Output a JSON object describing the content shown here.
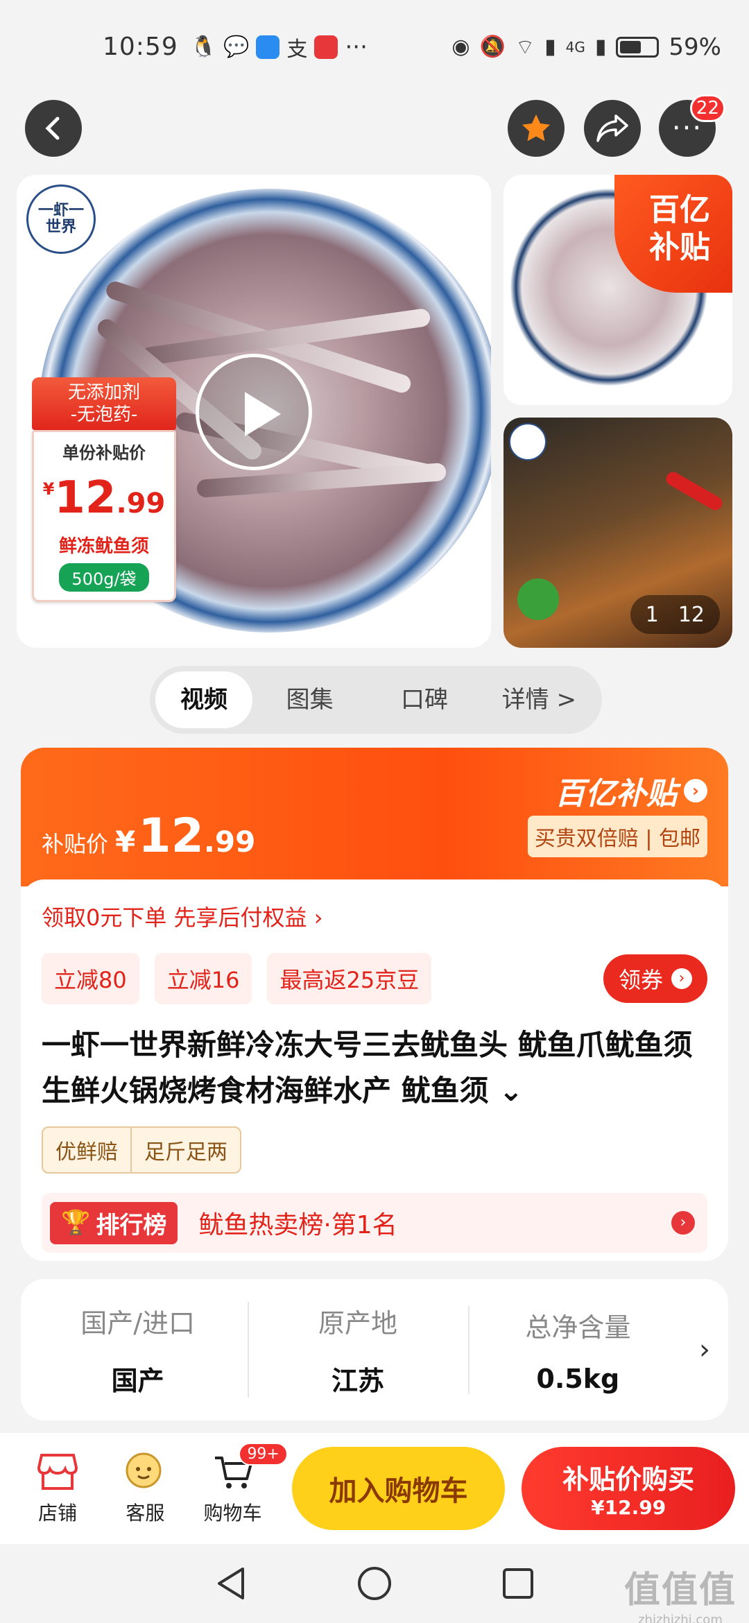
{
  "status_bar": {
    "time": "10:59",
    "battery": "59%",
    "network": "4G",
    "battery_level": 0.59
  },
  "nav": {
    "notification_count": "22"
  },
  "media": {
    "brand": "一虾一世界",
    "tag_top": [
      "无添加剂",
      "-无泡药-"
    ],
    "tag_label": "单份补贴价",
    "tag_currency": "¥",
    "tag_price_int": "12",
    "tag_price_dec": ".99",
    "tag_name": "鲜冻鱿鱼须",
    "tag_weight": "500g/袋",
    "subsidy_corner": [
      "百亿",
      "补贴"
    ],
    "gallery_index": "1",
    "gallery_total": "12"
  },
  "tabs": [
    {
      "label": "视频",
      "active": true
    },
    {
      "label": "图集",
      "active": false
    },
    {
      "label": "口碑",
      "active": false
    },
    {
      "label": "详情 >",
      "active": false
    }
  ],
  "price": {
    "label": "补贴价",
    "currency": "¥",
    "int": "12",
    "dec": ".99",
    "subsidy_logo": "百亿补贴",
    "guarantee": "买贵双倍赔 | 包邮",
    "pay_later": "领取0元下单 先享后付权益 ›",
    "chips": [
      "立减80",
      "立减16",
      "最高返25京豆"
    ],
    "coupon": "领券",
    "title": "一虾一世界新鲜冷冻大号三去鱿鱼头 鱿鱼爪鱿鱼须生鲜火锅烧烤食材海鲜水产 鱿鱼须 ⌄",
    "pills": [
      "优鲜赔",
      "足斤足两"
    ],
    "rank_tag": "排行榜",
    "rank_text": "鱿鱼热卖榜·第1名"
  },
  "specs": [
    {
      "key": "国产/进口",
      "value": "国产"
    },
    {
      "key": "原产地",
      "value": "江苏"
    },
    {
      "key": "总净含量",
      "value": "0.5kg"
    }
  ],
  "bottom_bar": {
    "store": "店铺",
    "service": "客服",
    "cart": "购物车",
    "cart_badge": "99+",
    "add_cart": "加入购物车",
    "buy_title": "补贴价购买",
    "buy_price": "¥12.99"
  },
  "watermark": {
    "text": "值值值",
    "site": "zhizhizhi.com"
  },
  "colors": {
    "accent": "#ff5a1a",
    "red": "#e2231a",
    "yellow": "#ffd01a"
  }
}
